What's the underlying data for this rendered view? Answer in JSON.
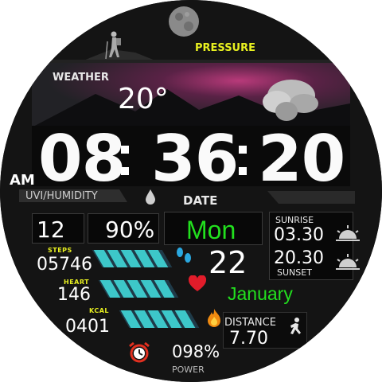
{
  "colors": {
    "accent_green": "#22e01e",
    "label_yellow": "#e8f020",
    "bar_cyan": "#3dc7c9",
    "heart_red": "#e21c2a"
  },
  "pressure": {
    "label": "PRESSURE"
  },
  "weather": {
    "label": "WEATHER",
    "temp": "20°"
  },
  "time": {
    "hours": "08",
    "minutes": "36",
    "seconds": "20",
    "ampm": "AM"
  },
  "uvi": {
    "label": "UVI/HUMIDITY",
    "uv": "12",
    "humidity": "90%"
  },
  "date": {
    "label": "DATE",
    "day": "Mon",
    "day_num": "22",
    "month": "January"
  },
  "sun": {
    "sunrise_label": "SUNRISE",
    "sunrise": "03.30",
    "sunset": "20.30",
    "sunset_label": "SUNSET"
  },
  "steps": {
    "label": "STEPS",
    "value": "05746",
    "segments_filled": 5
  },
  "heart": {
    "label": "HEART",
    "value": "146",
    "segments_filled": 5
  },
  "kcal": {
    "label": "KCAL",
    "value": "0401",
    "segments_filled": 5
  },
  "distance": {
    "label": "DISTANCE",
    "value": "7.70"
  },
  "power": {
    "value": "098%",
    "label": "POWER"
  },
  "icons": [
    "moon-icon",
    "hiker-icon",
    "cloud-icon",
    "drop-icon",
    "footsteps-icon",
    "heart-icon",
    "flame-icon",
    "runner-icon",
    "alarm-icon",
    "sunrise-icon",
    "sunset-icon"
  ]
}
